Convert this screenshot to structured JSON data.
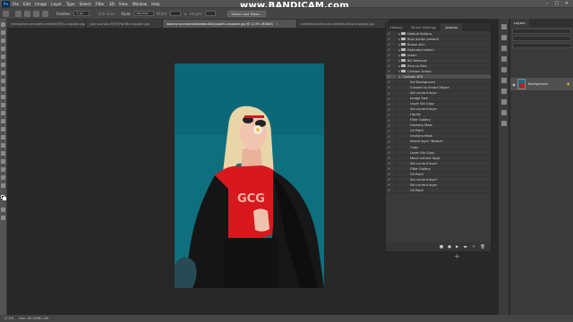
{
  "menu": {
    "logo": "Ps",
    "items": [
      "File",
      "Edit",
      "Image",
      "Layer",
      "Type",
      "Select",
      "Filter",
      "3D",
      "View",
      "Window",
      "Help"
    ]
  },
  "watermark": "www.BANDICAM.com",
  "window_controls": [
    "–",
    "□",
    "✕"
  ],
  "options_bar": {
    "feather_label": "Feather:",
    "feather_value": "0 px",
    "antialias_label": "Anti-alias",
    "style_label": "Style:",
    "style_value": "Normal",
    "width_label": "Width:",
    "height_label": "Height:",
    "select_mask_button": "Select and Mask..."
  },
  "tabs": [
    {
      "label": "christopher-campbell-rUmhbK9TRQ-unsplash.jpg",
      "active": false
    },
    {
      "label": "juan-scarlato-9jT5VPqr0BI-unsplash.jpg",
      "active": false
    },
    {
      "label": "katarzyna-mobrudzkowska-Bkd.jsqeX0-unsplash.jpg @ 12.5% (RGB/8)",
      "active": true
    },
    {
      "label": "matthew-wiebe.com-vaikhak-bBnq-unsplash.jpg",
      "active": false
    }
  ],
  "actions_panel": {
    "tabs": [
      "History",
      "Brush Settings",
      "Actions"
    ],
    "active_tab": "Actions",
    "rows": [
      {
        "kind": "set",
        "label": "Default Actions"
      },
      {
        "kind": "set",
        "label": "Bolo Action present"
      },
      {
        "kind": "set",
        "label": "Brown skin"
      },
      {
        "kind": "set",
        "label": "Detentad sketch"
      },
      {
        "kind": "set",
        "label": "retain"
      },
      {
        "kind": "set",
        "label": "BG Remover"
      },
      {
        "kind": "set",
        "label": "Zero to Skin"
      },
      {
        "kind": "set",
        "label": "Cartoon Action"
      },
      {
        "kind": "action",
        "label": "Cartoon ATN",
        "selected": true
      },
      {
        "kind": "step",
        "label": "Set Background"
      },
      {
        "kind": "step",
        "label": "Convert to Smart Object"
      },
      {
        "kind": "step",
        "label": "Set current layer"
      },
      {
        "kind": "step",
        "label": "Image Size"
      },
      {
        "kind": "step",
        "label": "Layer Via Copy"
      },
      {
        "kind": "step",
        "label": "Set current layer"
      },
      {
        "kind": "step",
        "label": "Liquify"
      },
      {
        "kind": "step",
        "label": "Filter Gallery"
      },
      {
        "kind": "step",
        "label": "Unsharp Mask"
      },
      {
        "kind": "step",
        "label": "Oil Paint"
      },
      {
        "kind": "step",
        "label": "Unsharp Mask"
      },
      {
        "kind": "step",
        "label": "Select layer \"Before\""
      },
      {
        "kind": "step",
        "label": "Copy"
      },
      {
        "kind": "step",
        "label": "Layer Via Copy"
      },
      {
        "kind": "step",
        "label": "Move current layer"
      },
      {
        "kind": "step",
        "label": "Set current layer"
      },
      {
        "kind": "step",
        "label": "Filter Gallery"
      },
      {
        "kind": "step",
        "label": "Oil Paint"
      },
      {
        "kind": "step",
        "label": "Set current layer"
      },
      {
        "kind": "step",
        "label": "Set current layer"
      },
      {
        "kind": "step",
        "label": "Oil Paint"
      }
    ],
    "footer_buttons": [
      "■",
      "●",
      "▶",
      "▬",
      "＋",
      "🗑"
    ]
  },
  "layers_panel": {
    "tab": "Layers",
    "layer_name": "Background",
    "lock_icon": "lock-icon"
  },
  "status": {
    "zoom": "12.5%",
    "doc": "Doc: 62.2M/62.2M"
  },
  "colors": {
    "photo_bg": "#0e6f7f",
    "shirt": "#d7191e",
    "jacket": "#151515",
    "panel": "#3a3a3a",
    "chrome": "#535353"
  }
}
